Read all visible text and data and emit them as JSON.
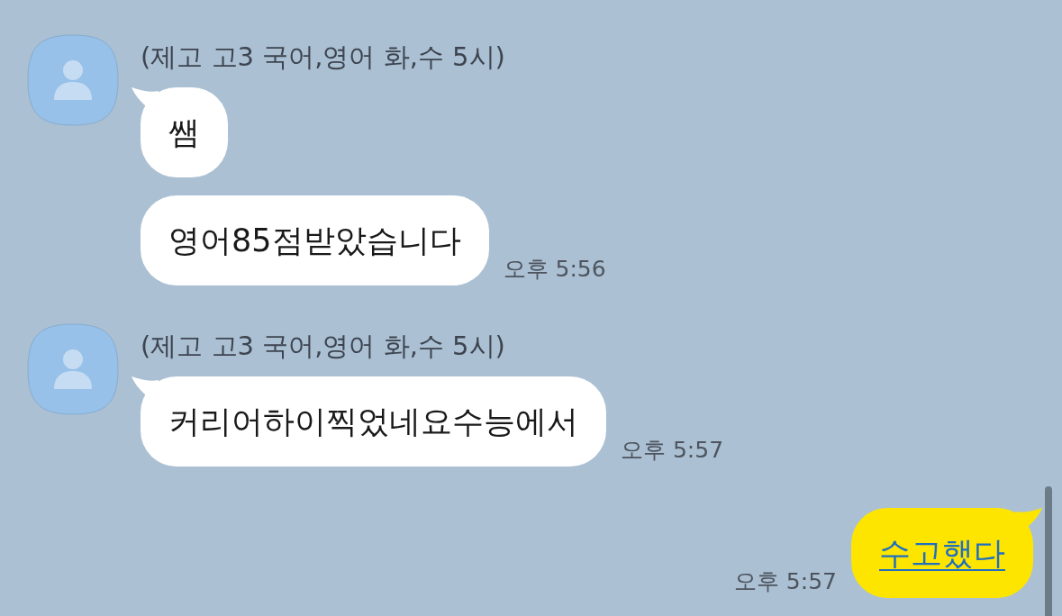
{
  "groups": [
    {
      "kind": "received",
      "sender": "(제고 고3 국어,영어 화,수 5시)",
      "messages": [
        {
          "text": "쌤"
        },
        {
          "text": "영어85점받았습니다",
          "time": "오후 5:56"
        }
      ]
    },
    {
      "kind": "received",
      "sender": "(제고 고3 국어,영어 화,수 5시)",
      "messages": [
        {
          "text": "커리어하이찍었네요수능에서",
          "time": "오후 5:57"
        }
      ]
    },
    {
      "kind": "sent",
      "messages": [
        {
          "text": "수고했다",
          "time": "오후 5:57",
          "link": true
        }
      ]
    }
  ]
}
